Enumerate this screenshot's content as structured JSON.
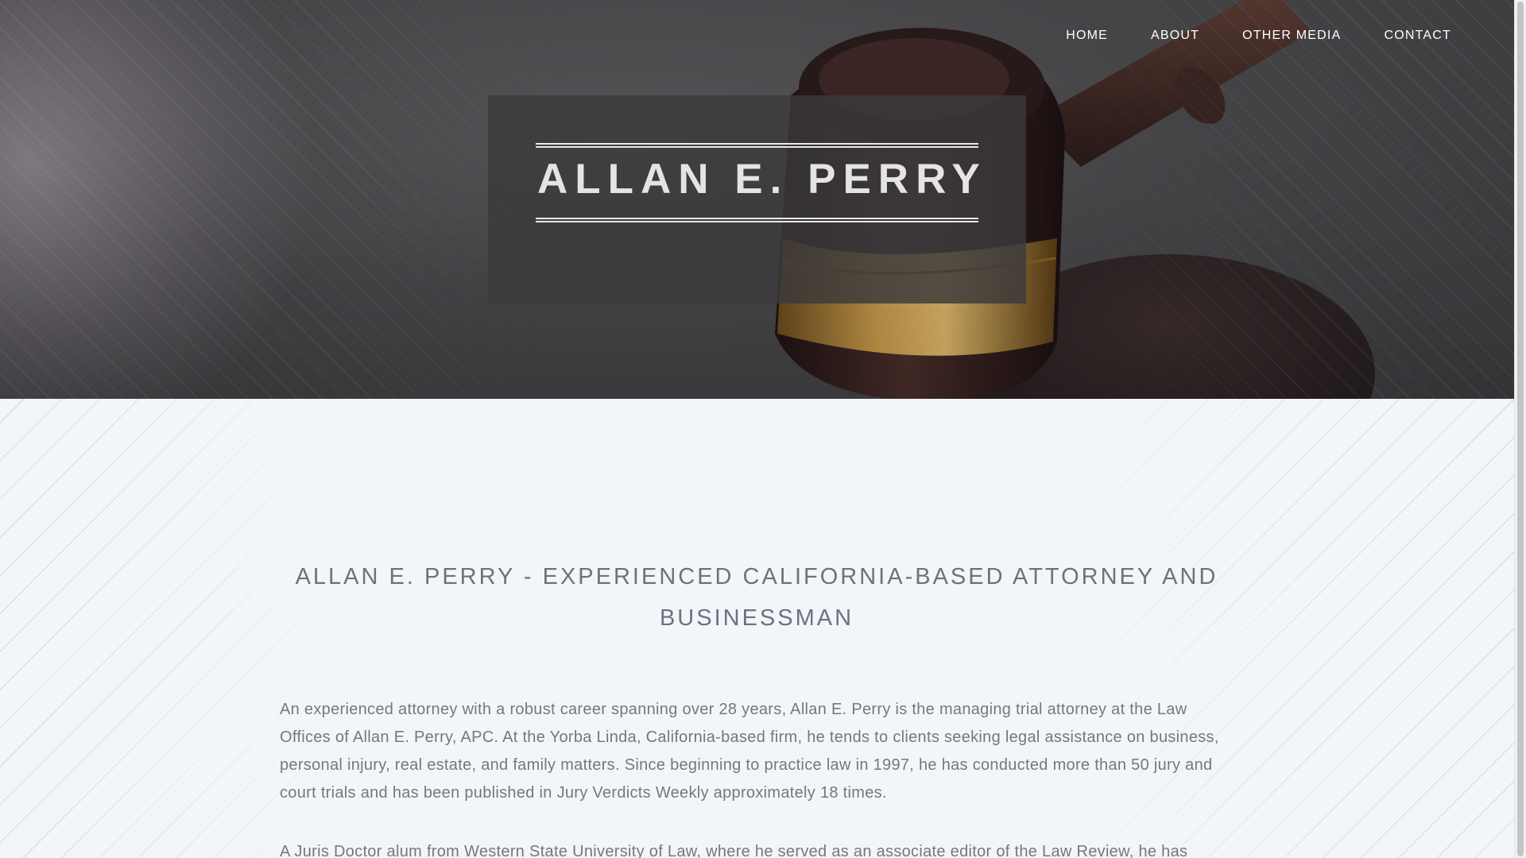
{
  "nav": {
    "items": [
      {
        "label": "HOME"
      },
      {
        "label": "ABOUT"
      },
      {
        "label": "OTHER MEDIA"
      },
      {
        "label": "CONTACT"
      }
    ]
  },
  "hero": {
    "title": "ALLAN E. PERRY"
  },
  "main": {
    "heading": "ALLAN E. PERRY - EXPERIENCED CALIFORNIA-BASED ATTORNEY AND BUSINESSMAN",
    "paragraphs": [
      "An experienced attorney with a robust career spanning over 28 years, Allan E. Perry is the managing trial attorney at the Law Offices of Allan E. Perry, APC. At the Yorba Linda, California-based firm, he tends to clients seeking legal assistance on business, personal injury, real estate, and family matters. Since beginning to practice law in 1997, he has conducted more than 50 jury and court trials and has been published in Jury Verdicts Weekly approximately 18 times.",
      "A Juris Doctor alum from Western State University of Law, where he served as an associate editor of the Law Review, he has"
    ]
  },
  "colors": {
    "hero_overlay": "#3a393c",
    "title_text": "#e4e4e4",
    "heading_text": "#6b7280",
    "body_text": "#737880",
    "page_background": "#f3f6f9"
  }
}
